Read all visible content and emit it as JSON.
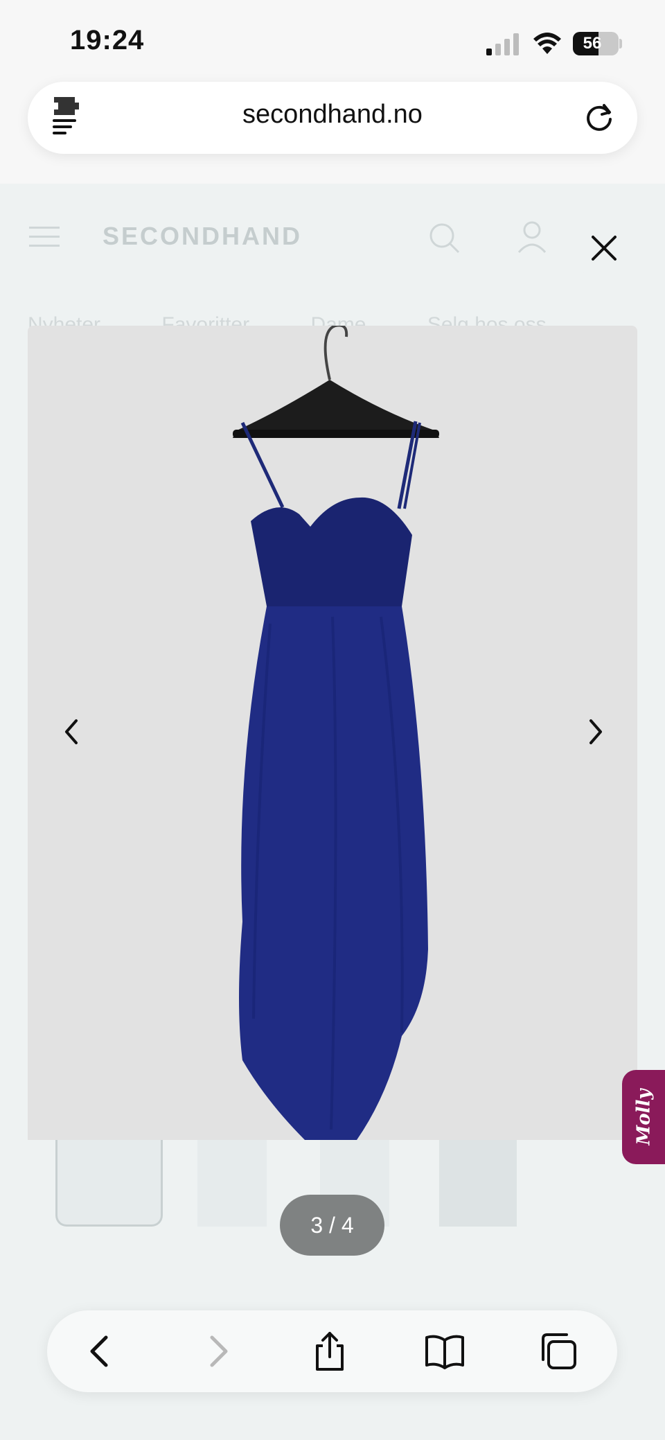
{
  "status_bar": {
    "time": "19:24",
    "battery_level": "56",
    "battery_fraction": 0.56
  },
  "browser": {
    "url": "secondhand.no",
    "icons": [
      "extension-icon",
      "reload-icon"
    ]
  },
  "site": {
    "logo": "SECONDHAND",
    "nav_items": [
      "Nyheter",
      "Favoritter",
      "Dame",
      "Selg hos oss"
    ]
  },
  "gallery": {
    "counter": "3 / 4",
    "current_index": 3,
    "total": 4,
    "photo_description_icon": "dress-photo",
    "dress_color": "#1e2a78",
    "frame_color": "#e2e2e2"
  },
  "chat_widget": {
    "label": "Molly",
    "color": "#8a1a5a"
  },
  "toolbar": {
    "icons": [
      "back-icon",
      "forward-icon",
      "share-icon",
      "bookmarks-icon",
      "tabs-icon"
    ]
  }
}
